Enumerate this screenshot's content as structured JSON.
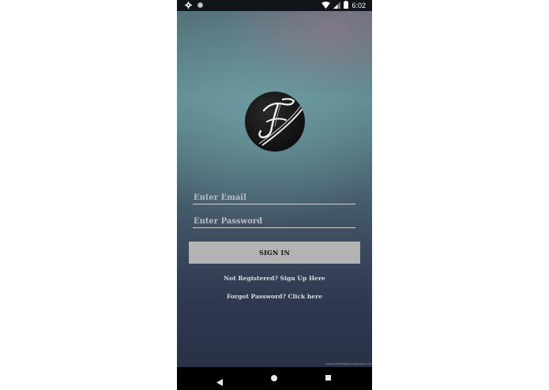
{
  "status_bar": {
    "time": "6:02",
    "left_icons": [
      "gear-icon",
      "circle-icon"
    ],
    "right_icons": [
      "wifi-icon",
      "signal-icon",
      "battery-icon"
    ]
  },
  "login": {
    "logo_letter": "F",
    "email_placeholder": "Enter Email",
    "password_placeholder": "Enter Password",
    "signin_label": "SIGN IN",
    "register_link": "Not Registered? Sign Up Here",
    "forgot_link": "Forgot Password? Click here",
    "watermark": "www.freebackgroundsstock.com"
  },
  "nav_bar": {
    "icons": [
      "back-icon",
      "home-icon",
      "recents-icon"
    ]
  },
  "colors": {
    "button_bg": "#b3b3b3",
    "text_light": "#d9dcdf",
    "status_bar_bg": "#111418",
    "nav_bar_bg": "#000000"
  }
}
